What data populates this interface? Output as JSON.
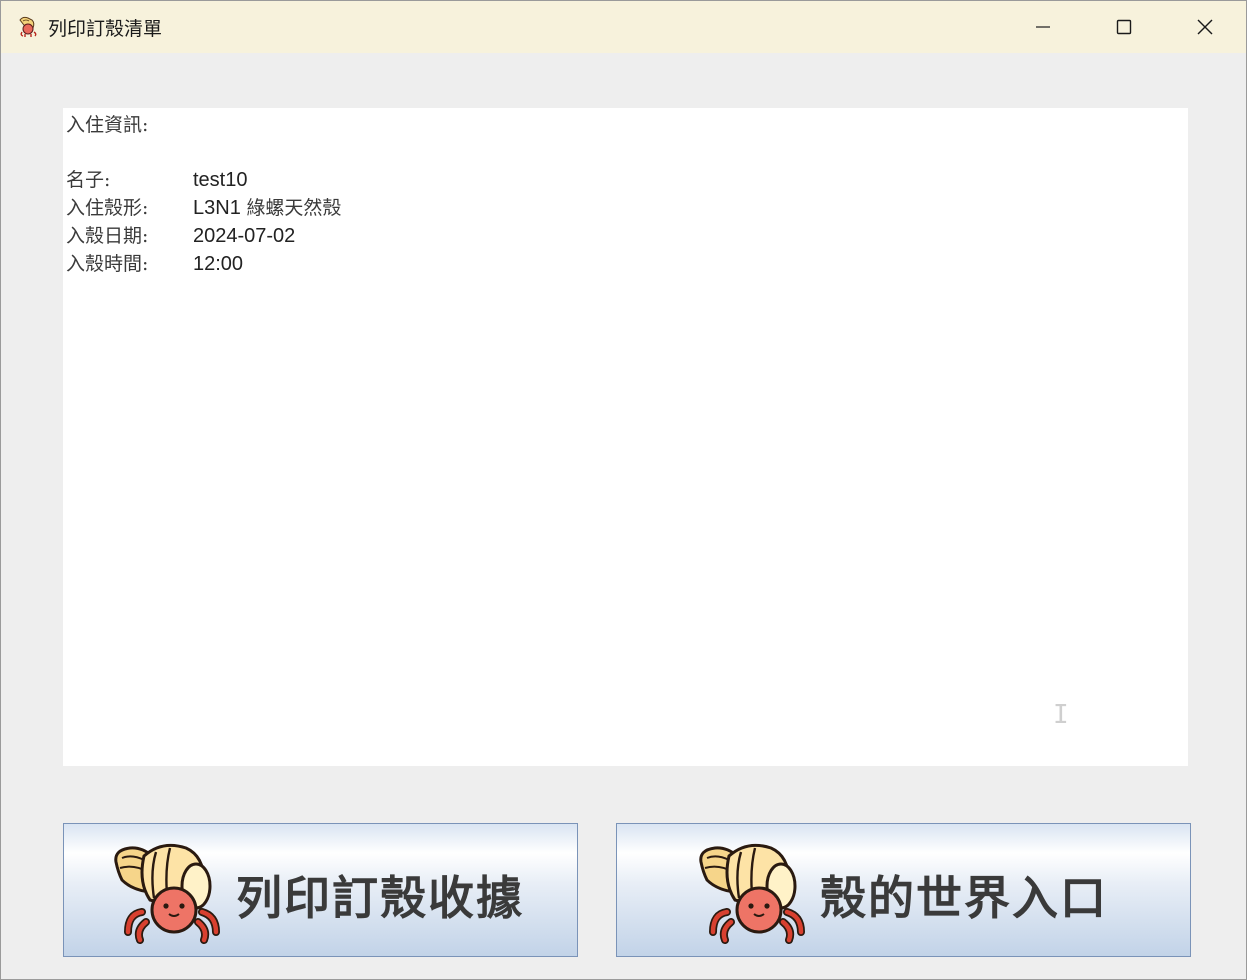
{
  "window": {
    "title": "列印訂殼清單",
    "controls": {
      "minimize": "minimize-icon",
      "maximize": "maximize-icon",
      "close": "close-icon"
    }
  },
  "info": {
    "heading": "入住資訊:",
    "rows": [
      {
        "label": "名子:",
        "value": "test10"
      },
      {
        "label": "入住殼形:",
        "value_code": "L3N1",
        "value_name": "綠螺天然殼"
      },
      {
        "label": "入殼日期:",
        "value": "2024-07-02"
      },
      {
        "label": "入殼時間:",
        "value": "12:00"
      }
    ]
  },
  "buttons": {
    "print_receipt": "列印訂殼收據",
    "shell_world": "殼的世界入口",
    "icon": "hermit-crab-icon"
  },
  "colors": {
    "titlebar": "#f7f2dc",
    "window_bg": "#eeeeee",
    "button_border": "#7a93b8"
  }
}
